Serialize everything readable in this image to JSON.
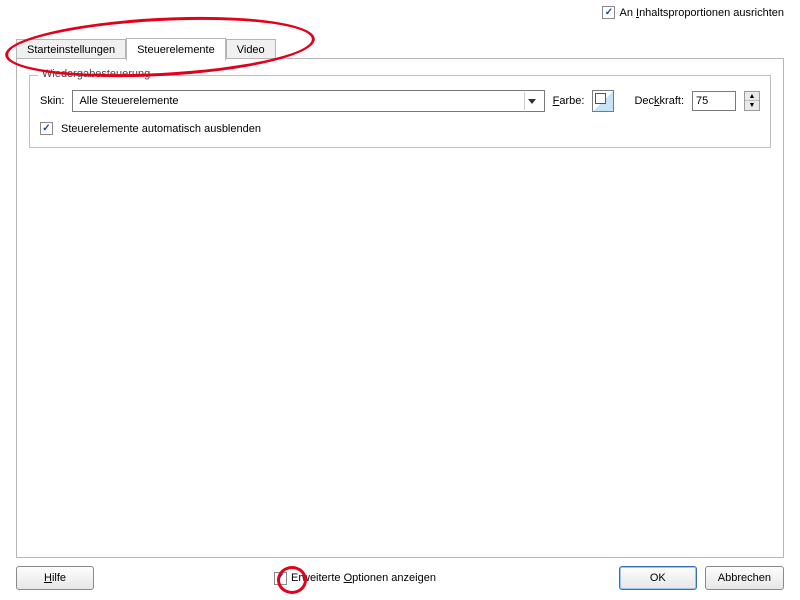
{
  "topCheckbox": {
    "checked": true,
    "label_pre": "An ",
    "label_u": "I",
    "label_post": "nhaltsproportionen ausrichten"
  },
  "tabs": {
    "start": "Starteinstellungen",
    "steuer": "Steuerelemente",
    "video": "Video"
  },
  "fieldset": {
    "legend": "Wiedergabesteuerung",
    "skinLabel": "Skin:",
    "skinValue": "Alle Steuerelemente",
    "colorLabel_u": "F",
    "colorLabel_post": "arbe:",
    "opacityLabel": "Dec",
    "opacityLabel_u": "k",
    "opacityLabel_post": "kraft:",
    "opacityValue": "75",
    "autoHide": {
      "checked": true,
      "label": "Steuerelemente automatisch ausblenden"
    }
  },
  "bottom": {
    "help_u": "H",
    "help_post": "ilfe",
    "advanced": {
      "checked": true,
      "label_pre": "Erweiterte ",
      "label_u": "O",
      "label_post": "ptionen anzeigen"
    },
    "ok": "OK",
    "cancel": "Abbrechen"
  }
}
